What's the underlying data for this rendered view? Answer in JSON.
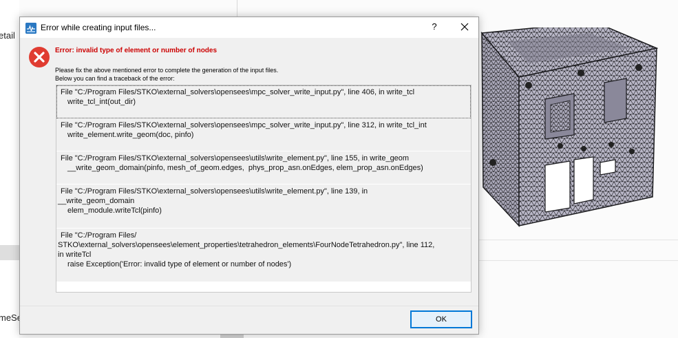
{
  "background": {
    "left_text_top": "etail",
    "left_text_bottom": "meSe"
  },
  "dialog": {
    "title": "Error while creating input files...",
    "help_label": "?",
    "error_heading": "Error: invalid type of element or number of nodes",
    "message_line1": "Please fix the above mentioned error to complete the generation of the input files.",
    "message_line2": "Below you can find a traceback of the error:",
    "traceback": [
      {
        "lines": [
          {
            "text": "File \"C:/Program Files/STKO\\external_solvers\\opensees\\mpc_solver_write_input.py\", line 406, in write_tcl",
            "indent": false
          },
          {
            "text": "write_tcl_int(out_dir)",
            "indent": true
          }
        ]
      },
      {
        "lines": [
          {
            "text": "File \"C:/Program Files/STKO\\external_solvers\\opensees\\mpc_solver_write_input.py\", line 312, in write_tcl_int",
            "indent": false
          },
          {
            "text": "write_element.write_geom(doc, pinfo)",
            "indent": true
          }
        ]
      },
      {
        "lines": [
          {
            "text": "File \"C:/Program Files/STKO\\external_solvers\\opensees\\utils\\write_element.py\", line 155, in write_geom",
            "indent": false
          },
          {
            "text": "__write_geom_domain(pinfo, mesh_of_geom.edges,  phys_prop_asn.onEdges, elem_prop_asn.onEdges)",
            "indent": true
          }
        ]
      },
      {
        "lines": [
          {
            "text": "File \"C:/Program Files/STKO\\external_solvers\\opensees\\utils\\write_element.py\", line 139, in",
            "indent": false
          },
          {
            "text": "__write_geom_domain",
            "indent": false
          },
          {
            "text": "elem_module.writeTcl(pinfo)",
            "indent": true
          }
        ]
      },
      {
        "lines": [
          {
            "text": "File \"C:/Program Files/",
            "indent": false
          },
          {
            "text": "STKO\\external_solvers\\opensees\\element_properties\\tetrahedron_elements\\FourNodeTetrahedron.py\", line 112,",
            "indent": false
          },
          {
            "text": "in writeTcl",
            "indent": false
          },
          {
            "text": "raise Exception('Error: invalid type of element or number of nodes')",
            "indent": true
          }
        ]
      }
    ],
    "ok_label": "OK"
  },
  "colors": {
    "error_red": "#e03c31",
    "heading_red": "#cc0000",
    "button_border": "#0078d7"
  },
  "icons": {
    "app": "stko-app-icon",
    "close": "close-icon",
    "error": "error-icon"
  }
}
